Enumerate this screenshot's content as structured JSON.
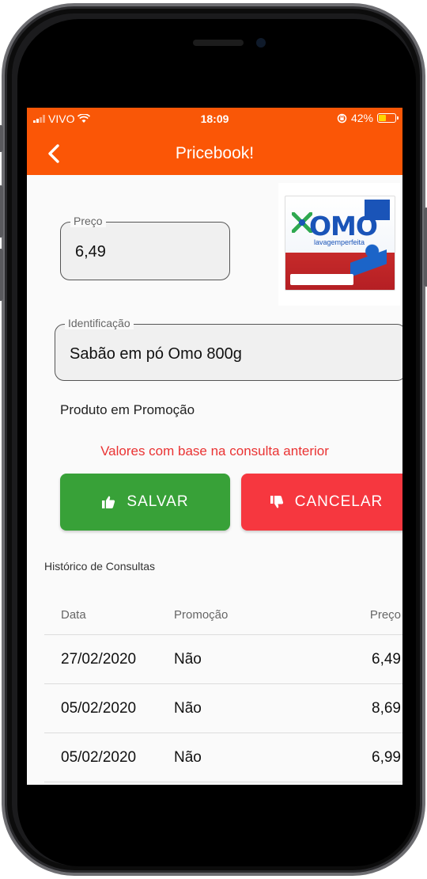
{
  "status_bar": {
    "carrier": "VIVO",
    "time": "18:09",
    "battery": "42%",
    "battery_level": 0.42,
    "battery_color": "#ffd600"
  },
  "app_bar": {
    "title": "Pricebook!",
    "back_icon": "chevron-left-icon",
    "color": "#fb5606"
  },
  "form": {
    "price_label": "Preço",
    "price_value": "6,49",
    "identification_label": "Identificação",
    "identification_value": "Sabão em pó Omo 800g",
    "promo_label": "Produto em Promoção",
    "warning": "Valores com base na consulta anterior",
    "product_image": "omo-detergent-box"
  },
  "product_image_text": {
    "brand": "OMO",
    "tagline": "lavagemperfeita"
  },
  "buttons": {
    "save": "SALVAR",
    "save_icon": "thumbs-up-icon",
    "save_color": "#38a138",
    "cancel": "CANCELAR",
    "cancel_icon": "thumbs-down-icon",
    "cancel_color": "#f6373f"
  },
  "history": {
    "title": "Histórico de Consultas",
    "columns": [
      "Data",
      "Promoção",
      "Preço"
    ],
    "rows": [
      {
        "date": "27/02/2020",
        "promo": "Não",
        "price": "6,49"
      },
      {
        "date": "05/02/2020",
        "promo": "Não",
        "price": "8,69"
      },
      {
        "date": "05/02/2020",
        "promo": "Não",
        "price": "6,99"
      }
    ]
  }
}
